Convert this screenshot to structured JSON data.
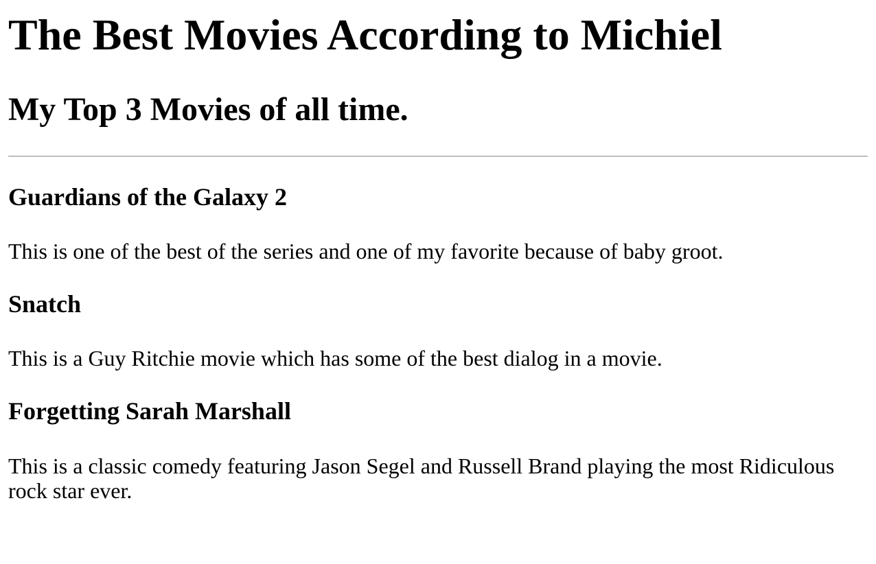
{
  "page": {
    "title": "The Best Movies According to Michiel",
    "subtitle": "My Top 3 Movies of all time."
  },
  "movies": [
    {
      "title": "Guardians of the Galaxy 2",
      "description": "This is one of the best of the series and one of my favorite because of baby groot."
    },
    {
      "title": "Snatch",
      "description": "This is a Guy Ritchie movie which has some of the best dialog in a movie."
    },
    {
      "title": "Forgetting Sarah Marshall",
      "description": "This is a classic comedy featuring Jason Segel and Russell Brand playing the most Ridiculous rock star ever."
    }
  ]
}
